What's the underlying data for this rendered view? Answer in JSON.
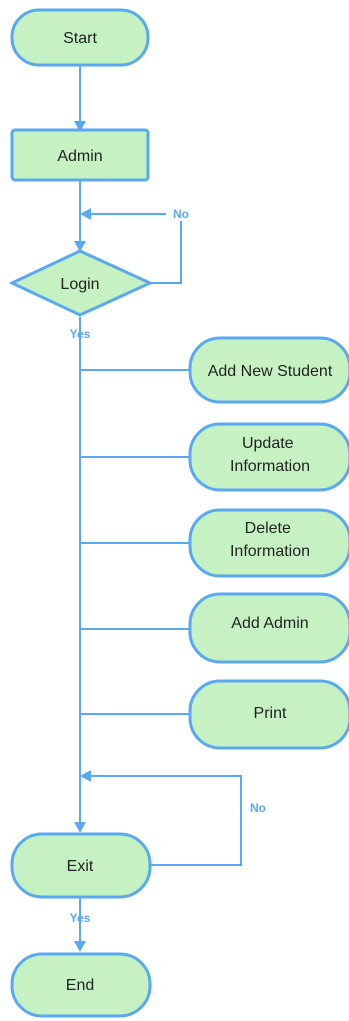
{
  "colors": {
    "node_fill": "#c6f1c3",
    "node_stroke": "#5aa9f0",
    "edge": "#5aa9f0",
    "text": "#222222",
    "edge_label": "#5aa9f0"
  },
  "nodes": {
    "start": "Start",
    "admin": "Admin",
    "login": "Login",
    "add_new_student": "Add New Student",
    "update_information": [
      "Update",
      "Information"
    ],
    "delete_information": [
      "Delete",
      "Information"
    ],
    "add_admin": "Add Admin",
    "print": "Print",
    "exit": "Exit",
    "end": "End"
  },
  "edge_labels": {
    "login_no": "No",
    "login_yes": "Yes",
    "exit_no": "No",
    "exit_yes": "Yes"
  }
}
